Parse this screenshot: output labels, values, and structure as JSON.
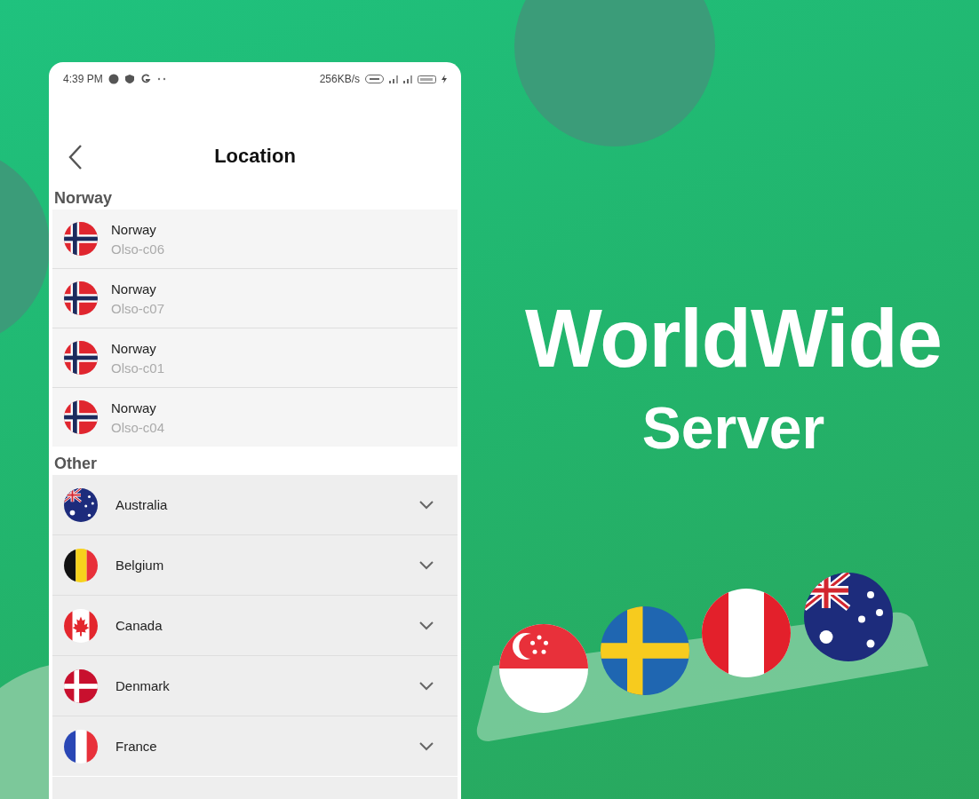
{
  "status_bar": {
    "time": "4:39 PM",
    "speed": "256KB/s"
  },
  "header": {
    "title": "Location"
  },
  "sections": [
    {
      "title": "Norway",
      "kind": "servers",
      "items": [
        {
          "country": "Norway",
          "server": "Olso-c06",
          "kind": "norway"
        },
        {
          "country": "Norway",
          "server": "Olso-c07",
          "kind": "norway"
        },
        {
          "country": "Norway",
          "server": "Olso-c01",
          "kind": "norway"
        },
        {
          "country": "Norway",
          "server": "Olso-c04",
          "kind": "norway"
        }
      ]
    },
    {
      "title": "Other",
      "kind": "countries",
      "items": [
        {
          "country": "Australia",
          "kind": "australia",
          "expanded": false
        },
        {
          "country": "Belgium",
          "kind": "belgium",
          "expanded": false
        },
        {
          "country": "Canada",
          "kind": "canada",
          "expanded": false
        },
        {
          "country": "Denmark",
          "kind": "denmark",
          "expanded": false
        },
        {
          "country": "France",
          "kind": "france",
          "expanded": false
        }
      ]
    }
  ],
  "promo": {
    "headline": "WorldWide",
    "subheadline": "Server",
    "flags": [
      {
        "kind": "singapore"
      },
      {
        "kind": "sweden"
      },
      {
        "kind": "peru"
      },
      {
        "kind": "australia"
      }
    ]
  }
}
